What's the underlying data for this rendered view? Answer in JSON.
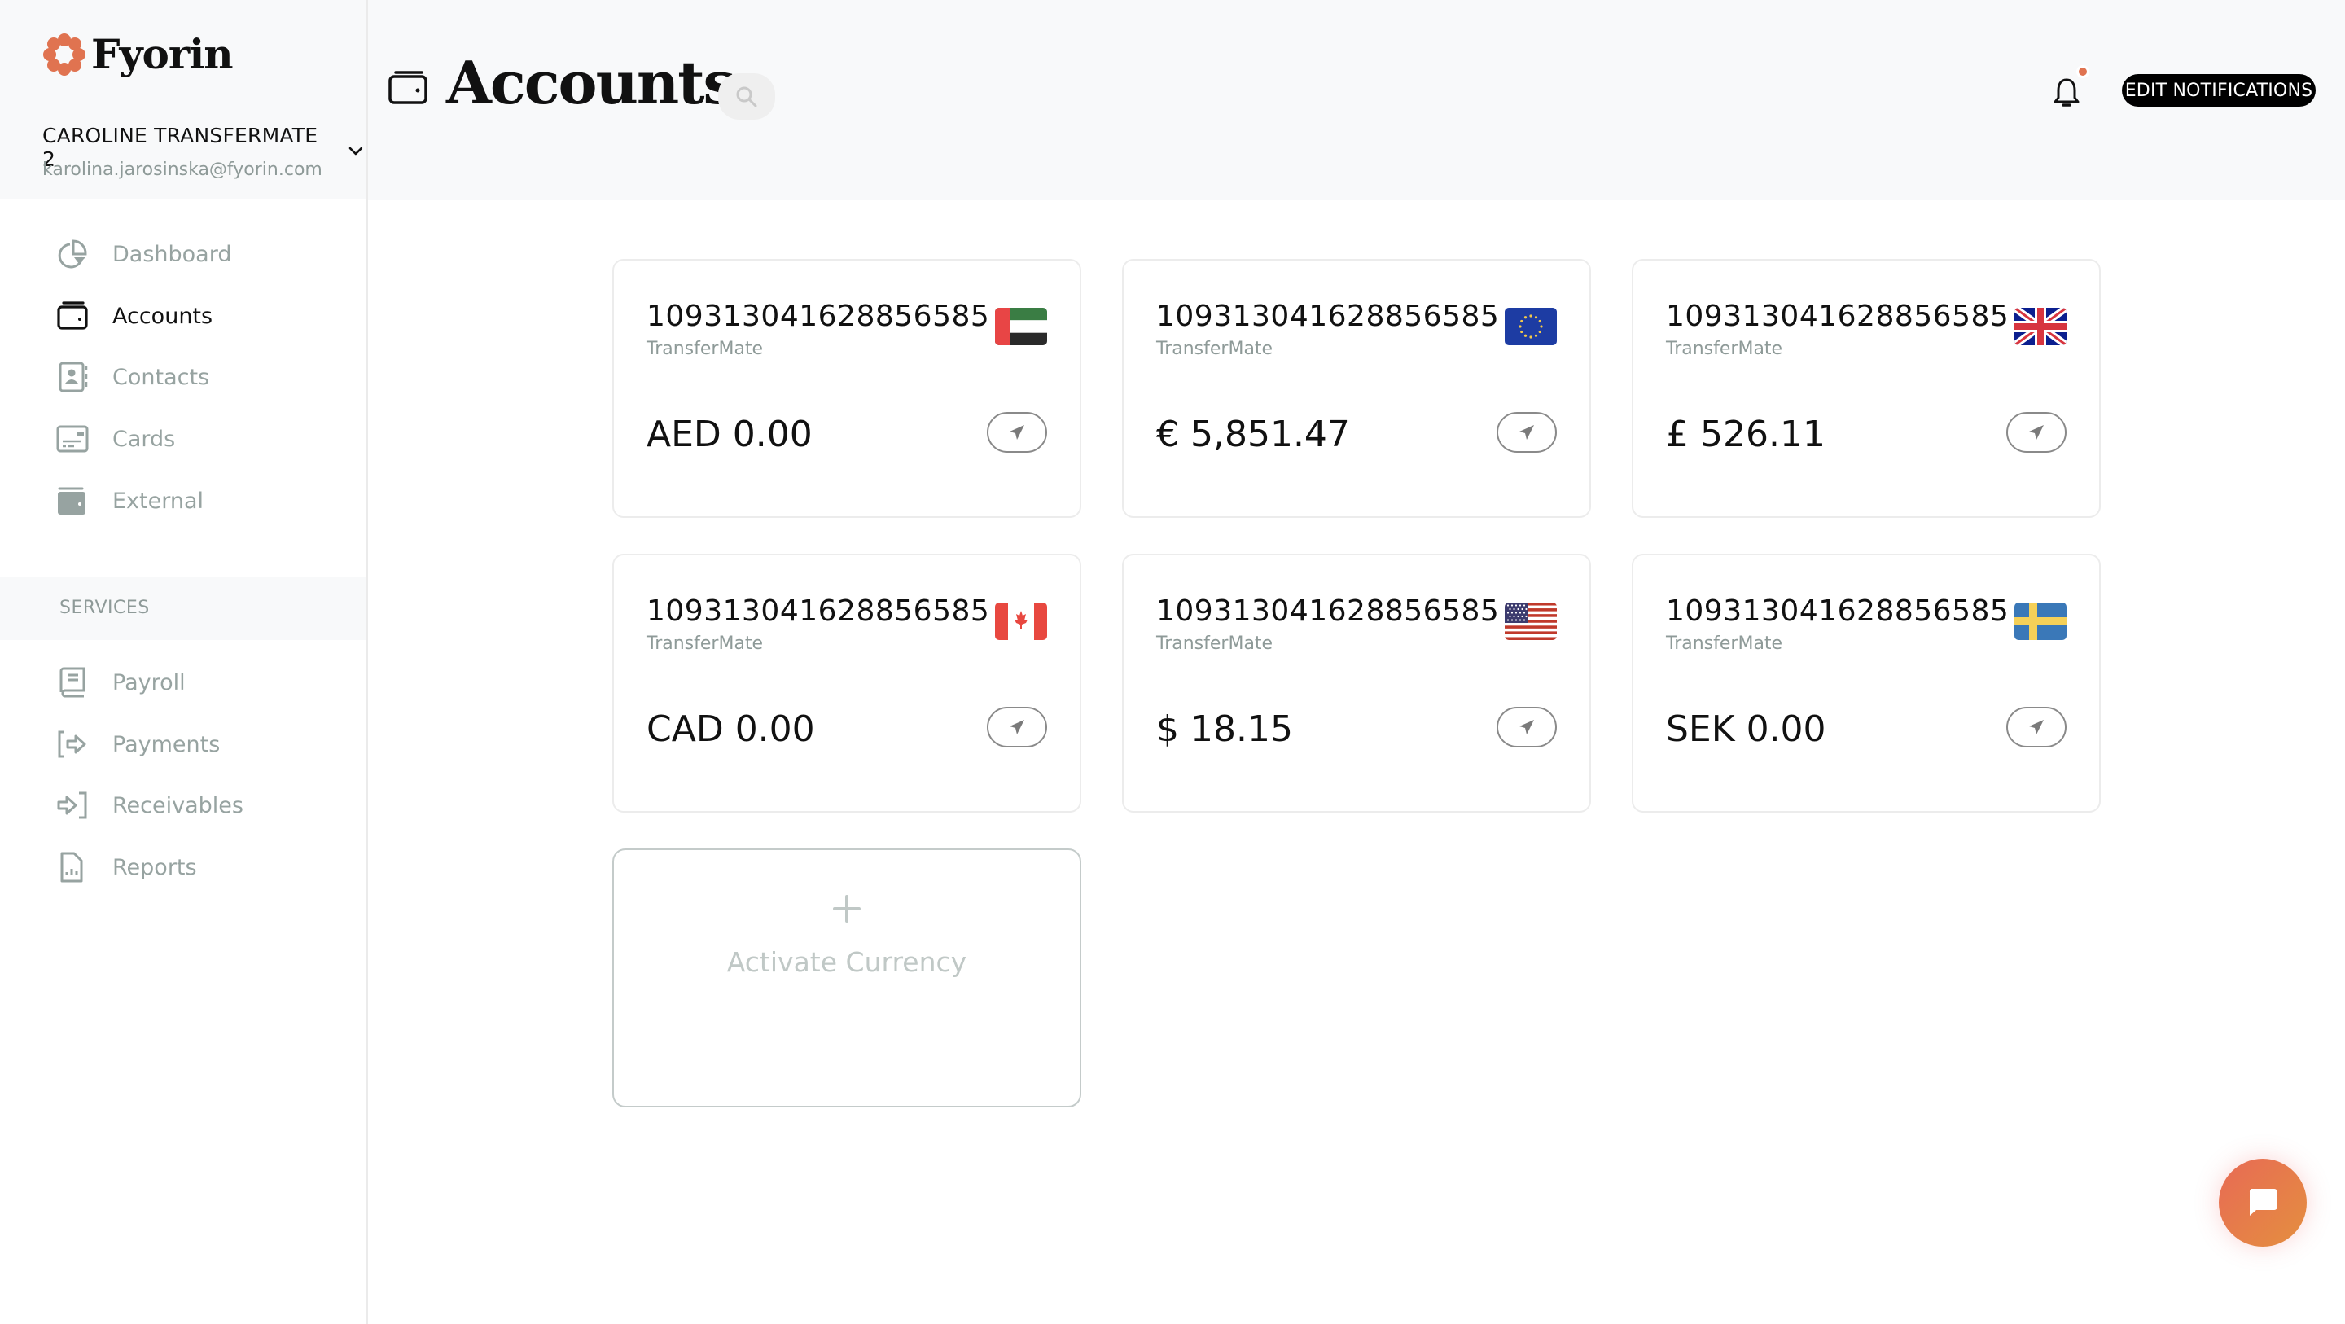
{
  "brand": {
    "name": "Fyorin",
    "accent": "#e07350"
  },
  "org": {
    "name": "CAROLINE TRANSFERMATE 2",
    "email": "karolina.jarosinska@fyorin.com"
  },
  "sidebar": {
    "main_items": [
      {
        "label": "Dashboard",
        "icon": "pie-chart-icon",
        "active": false
      },
      {
        "label": "Accounts",
        "icon": "wallet-icon",
        "active": true
      },
      {
        "label": "Contacts",
        "icon": "contact-book-icon",
        "active": false
      },
      {
        "label": "Cards",
        "icon": "credit-card-icon",
        "active": false
      },
      {
        "label": "External",
        "icon": "external-wallet-icon",
        "active": false
      }
    ],
    "services_label": "SERVICES",
    "service_items": [
      {
        "label": "Payroll",
        "icon": "payroll-book-icon"
      },
      {
        "label": "Payments",
        "icon": "payment-out-icon"
      },
      {
        "label": "Receivables",
        "icon": "receivable-in-icon"
      },
      {
        "label": "Reports",
        "icon": "report-file-icon"
      }
    ]
  },
  "header": {
    "title": "Accounts",
    "edit_notifications_label": "EDIT NOTIFICATIONS",
    "has_unread_notifications": true
  },
  "accounts": [
    {
      "number": "109313041628856585",
      "provider": "TransferMate",
      "balance": "AED 0.00",
      "currency": "AED",
      "flag": "uae-flag-icon"
    },
    {
      "number": "109313041628856585",
      "provider": "TransferMate",
      "balance": "€ 5,851.47",
      "currency": "EUR",
      "flag": "eu-flag-icon"
    },
    {
      "number": "109313041628856585",
      "provider": "TransferMate",
      "balance": "£ 526.11",
      "currency": "GBP",
      "flag": "uk-flag-icon"
    },
    {
      "number": "109313041628856585",
      "provider": "TransferMate",
      "balance": "CAD 0.00",
      "currency": "CAD",
      "flag": "canada-flag-icon"
    },
    {
      "number": "109313041628856585",
      "provider": "TransferMate",
      "balance": "$ 18.15",
      "currency": "USD",
      "flag": "us-flag-icon"
    },
    {
      "number": "109313041628856585",
      "provider": "TransferMate",
      "balance": "SEK 0.00",
      "currency": "SEK",
      "flag": "sweden-flag-icon"
    }
  ],
  "activate_currency_label": "Activate Currency"
}
